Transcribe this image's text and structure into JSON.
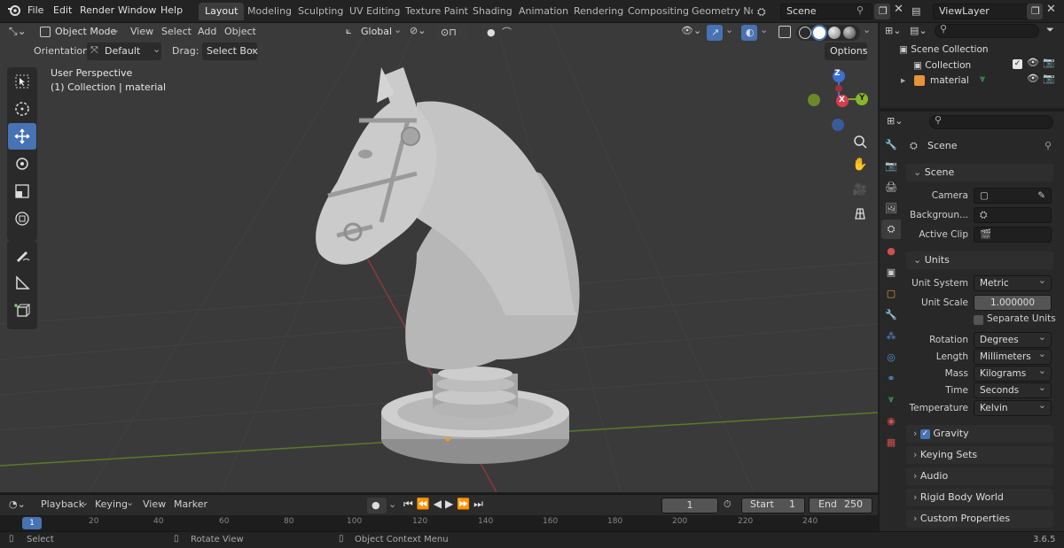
{
  "menus": [
    "File",
    "Edit",
    "Render",
    "Window",
    "Help"
  ],
  "workspaces": [
    "Layout",
    "Modeling",
    "Sculpting",
    "UV Editing",
    "Texture Paint",
    "Shading",
    "Animation",
    "Rendering",
    "Compositing",
    "Geometry Noc"
  ],
  "scene_field": "Scene",
  "viewlayer_field": "ViewLayer",
  "viewport_header": {
    "mode": "Object Mode",
    "menus": [
      "View",
      "Select",
      "Add",
      "Object"
    ],
    "transform": "Global"
  },
  "tool_header": {
    "orientation_label": "Orientation:",
    "orientation_value": "Default",
    "drag_label": "Drag:",
    "drag_value": "Select Box",
    "options": "Options"
  },
  "viewport_info": {
    "line1": "User Perspective",
    "line2": "(1) Collection | material"
  },
  "gizmo": {
    "z": "Z",
    "x": "X",
    "y": "Y"
  },
  "outliner": {
    "root": "Scene Collection",
    "collection": "Collection",
    "object": "material"
  },
  "properties": {
    "scene_name": "Scene",
    "scene_panel": "Scene",
    "camera_label": "Camera",
    "background_label": "Backgroun...",
    "clip_label": "Active Clip",
    "units_panel": "Units",
    "unit_system_label": "Unit System",
    "unit_system": "Metric",
    "unit_scale_label": "Unit Scale",
    "unit_scale": "1.000000",
    "separate_units": "Separate Units",
    "rotation_label": "Rotation",
    "rotation": "Degrees",
    "length_label": "Length",
    "length": "Millimeters",
    "mass_label": "Mass",
    "mass": "Kilograms",
    "time_label": "Time",
    "time": "Seconds",
    "temperature_label": "Temperature",
    "temperature": "Kelvin",
    "gravity": "Gravity",
    "keying_sets": "Keying Sets",
    "audio": "Audio",
    "rigid_body": "Rigid Body World",
    "custom_props": "Custom Properties"
  },
  "timeline": {
    "menus": [
      "Playback",
      "Keying",
      "View",
      "Marker"
    ],
    "current_frame": "1",
    "start_label": "Start",
    "start": "1",
    "end_label": "End",
    "end": "250",
    "ruler": [
      "1",
      "20",
      "40",
      "60",
      "80",
      "100",
      "120",
      "140",
      "160",
      "180",
      "200",
      "220",
      "240"
    ]
  },
  "status": {
    "select": "Select",
    "rotate": "Rotate View",
    "context": "Object Context Menu",
    "version": "3.6.5"
  },
  "colors": {
    "accent": "#4772b3",
    "viewport_bg": "#3a3a3a",
    "panel_bg": "#282828"
  }
}
